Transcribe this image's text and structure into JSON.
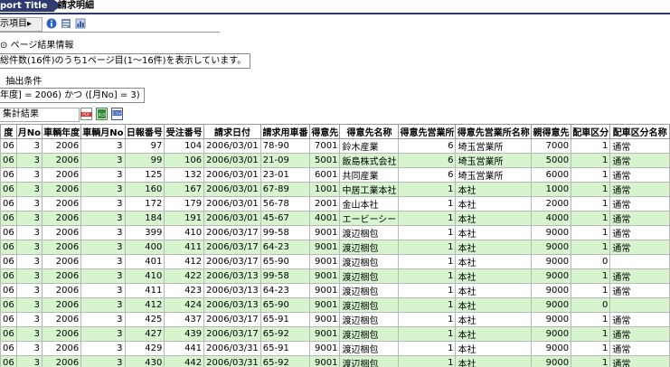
{
  "header": {
    "report_tag": "port Title",
    "title": "請求明細"
  },
  "toolbar": {
    "display_item_label": "示項目"
  },
  "page_info": {
    "label": "ページ結果情報",
    "text": "総件数(16件)のうち1ページ目(1〜16件)を表示しています。"
  },
  "filter": {
    "label": "抽出条件",
    "text": "年度] = 2006) かつ ([月No] = 3)"
  },
  "summary": {
    "button_label": "集計結果",
    "formats": [
      "PDF",
      "XLS",
      "CSV"
    ]
  },
  "table": {
    "columns": [
      "度",
      "月No",
      "車輌年度",
      "車輌月No",
      "日報番号",
      "受注番号",
      "請求日付",
      "請求用車番",
      "得意先",
      "得意先名称",
      "得意先営業所",
      "得意先営業所名称",
      "親得意先",
      "配車区分",
      "配車区分名称"
    ],
    "rows": [
      [
        "06",
        "3",
        "2006",
        "3",
        "97",
        "104",
        "2006/03/01",
        "78-90",
        "7001",
        "鈴木産業",
        "6",
        "埼玉営業所",
        "7000",
        "1",
        "通常"
      ],
      [
        "06",
        "3",
        "2006",
        "3",
        "99",
        "106",
        "2006/03/01",
        "21-09",
        "5001",
        "飯島株式会社",
        "6",
        "埼玉営業所",
        "5000",
        "1",
        "通常"
      ],
      [
        "06",
        "3",
        "2006",
        "3",
        "125",
        "132",
        "2006/03/01",
        "23-01",
        "6001",
        "共同産業",
        "6",
        "埼玉営業所",
        "6000",
        "1",
        "通常"
      ],
      [
        "06",
        "3",
        "2006",
        "3",
        "160",
        "167",
        "2006/03/01",
        "67-89",
        "1001",
        "中居工業本社",
        "1",
        "本社",
        "1000",
        "1",
        "通常"
      ],
      [
        "06",
        "3",
        "2006",
        "3",
        "172",
        "179",
        "2006/03/01",
        "56-78",
        "2001",
        "金山本社",
        "1",
        "本社",
        "2000",
        "1",
        "通常"
      ],
      [
        "06",
        "3",
        "2006",
        "3",
        "184",
        "191",
        "2006/03/01",
        "45-67",
        "4001",
        "エービーシー",
        "1",
        "本社",
        "4000",
        "1",
        "通常"
      ],
      [
        "06",
        "3",
        "2006",
        "3",
        "399",
        "410",
        "2006/03/17",
        "99-58",
        "9001",
        "渡辺梱包",
        "1",
        "本社",
        "9000",
        "1",
        "通常"
      ],
      [
        "06",
        "3",
        "2006",
        "3",
        "400",
        "411",
        "2006/03/17",
        "64-23",
        "9001",
        "渡辺梱包",
        "1",
        "本社",
        "9000",
        "1",
        "通常"
      ],
      [
        "06",
        "3",
        "2006",
        "3",
        "401",
        "412",
        "2006/03/17",
        "65-90",
        "9001",
        "渡辺梱包",
        "1",
        "本社",
        "9000",
        "0",
        ""
      ],
      [
        "06",
        "3",
        "2006",
        "3",
        "410",
        "422",
        "2006/03/13",
        "99-58",
        "9001",
        "渡辺梱包",
        "1",
        "本社",
        "9000",
        "1",
        "通常"
      ],
      [
        "06",
        "3",
        "2006",
        "3",
        "411",
        "423",
        "2006/03/13",
        "64-23",
        "9001",
        "渡辺梱包",
        "1",
        "本社",
        "9000",
        "1",
        "通常"
      ],
      [
        "06",
        "3",
        "2006",
        "3",
        "412",
        "424",
        "2006/03/13",
        "65-90",
        "9001",
        "渡辺梱包",
        "1",
        "本社",
        "9000",
        "0",
        ""
      ],
      [
        "06",
        "3",
        "2006",
        "3",
        "425",
        "437",
        "2006/03/17",
        "65-91",
        "9001",
        "渡辺梱包",
        "1",
        "本社",
        "9000",
        "1",
        "通常"
      ],
      [
        "06",
        "3",
        "2006",
        "3",
        "427",
        "439",
        "2006/03/17",
        "65-92",
        "9001",
        "渡辺梱包",
        "1",
        "本社",
        "9000",
        "1",
        "通常"
      ],
      [
        "06",
        "3",
        "2006",
        "3",
        "429",
        "441",
        "2006/03/31",
        "65-91",
        "9001",
        "渡辺梱包",
        "1",
        "本社",
        "9000",
        "1",
        "通常"
      ],
      [
        "06",
        "3",
        "2006",
        "3",
        "430",
        "442",
        "2006/03/31",
        "65-92",
        "9001",
        "渡辺梱包",
        "1",
        "本社",
        "9000",
        "1",
        "通常"
      ]
    ],
    "align": [
      "r",
      "r",
      "r",
      "r",
      "r",
      "r",
      "l",
      "l",
      "r",
      "l",
      "r",
      "l",
      "r",
      "r",
      "l"
    ]
  },
  "colors": {
    "header_blue": "#2f3a6e",
    "row_green": "#d6f5cf"
  }
}
